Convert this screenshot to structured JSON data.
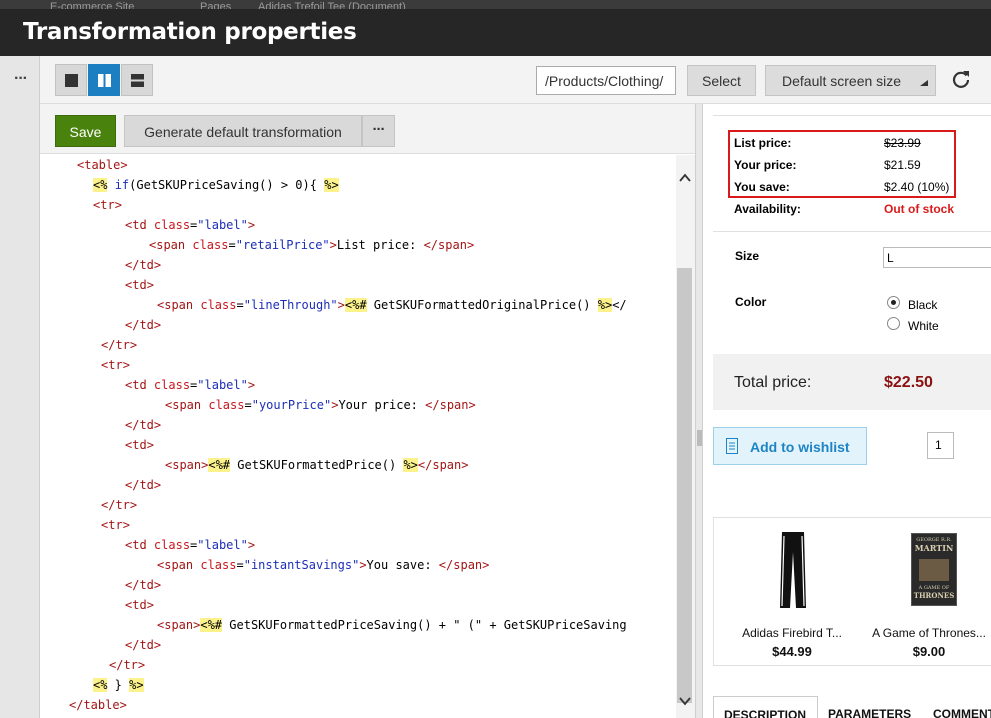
{
  "background": {
    "crumb1": "E-commerce Site",
    "crumb2": "Pages",
    "crumb3": "Adidas Trefoil Tee (Document)"
  },
  "dialog": {
    "title": "Transformation properties"
  },
  "left_panel": {
    "more_label": "···"
  },
  "toolbar": {
    "path_value": "/Products/Clothing/",
    "select_label": "Select",
    "screen_size_label": "Default screen size",
    "view_modes": [
      "code-only-icon",
      "split-view-icon",
      "preview-only-icon"
    ]
  },
  "editor": {
    "save_label": "Save",
    "generate_label": "Generate default transformation",
    "more_label": "···",
    "code_lines": [
      "<table>",
      "<% if(GetSKUPriceSaving() > 0){ %>",
      "<tr>",
      "<td class=\"label\">",
      "<span class=\"retailPrice\">List price: </span>",
      "</td>",
      "<td>",
      "<span class=\"lineThrough\"><%# GetSKUFormattedOriginalPrice() %></",
      "</td>",
      "</tr>",
      "<tr>",
      "<td class=\"label\">",
      "<span class=\"yourPrice\">Your price: </span>",
      "</td>",
      "<td>",
      "<span><%# GetSKUFormattedPrice() %></span>",
      "</td>",
      "</tr>",
      "<tr>",
      "<td class=\"label\">",
      "<span class=\"instantSavings\">You save: </span>",
      "</td>",
      "<td>",
      "<span><%# GetSKUFormattedPriceSaving() + \" (\" + GetSKUPriceSaving",
      "</td>",
      "</tr>",
      "<% } %>",
      "</table>"
    ]
  },
  "preview": {
    "list_price_label": "List price:",
    "list_price_value": "$23.99",
    "your_price_label": "Your price:",
    "your_price_value": "$21.59",
    "you_save_label": "You save:",
    "you_save_value": "$2.40 (10%)",
    "availability_label": "Availability:",
    "availability_value": "Out of stock",
    "size_label": "Size",
    "size_value": "L",
    "color_label": "Color",
    "color_options": [
      "Black",
      "White"
    ],
    "color_selected": "Black",
    "total_label": "Total price:",
    "total_value": "$22.50",
    "wishlist_label": "Add to wishlist",
    "quantity": "1",
    "related": [
      {
        "name": "Adidas Firebird T...",
        "price": "$44.99"
      },
      {
        "name": "A Game of Thrones...",
        "price": "$9.00"
      }
    ],
    "book_cover": {
      "line1": "GEORGE R.R.",
      "line2": "MARTIN",
      "line3": "A GAME OF",
      "line4": "THRONES"
    },
    "tabs": [
      "DESCRIPTION",
      "PARAMETERS",
      "COMMENTS"
    ]
  },
  "colors": {
    "accent_blue": "#1c7fc1",
    "save_green": "#49820c",
    "price_red": "#8a1111",
    "stock_red": "#d91a1a",
    "highlight_yellow": "#fbf28c"
  }
}
